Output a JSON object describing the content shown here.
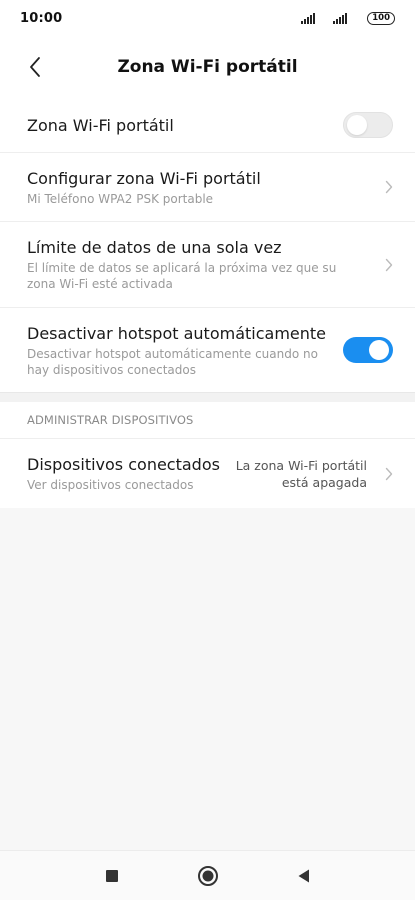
{
  "status_bar": {
    "time": "10:00",
    "battery": "100"
  },
  "header": {
    "title": "Zona Wi-Fi portátil",
    "back_icon": "chevron-left-icon"
  },
  "settings": {
    "hotspot": {
      "title": "Zona Wi-Fi portátil",
      "enabled": false
    },
    "configure": {
      "title": "Configurar zona Wi-Fi portátil",
      "subtitle": "Mi Teléfono WPA2 PSK portable"
    },
    "data_limit": {
      "title": "Límite de datos de una sola vez",
      "subtitle": "El límite de datos se aplicará la próxima vez que su zona Wi-Fi esté activada"
    },
    "auto_off": {
      "title": "Desactivar hotspot automáticamente",
      "subtitle": "Desactivar hotspot automáticamente cuando no hay dispositivos conectados",
      "enabled": true
    }
  },
  "devices_section": {
    "header": "ADMINISTRAR DISPOSITIVOS",
    "connected": {
      "title": "Dispositivos conectados",
      "subtitle": "Ver dispositivos conectados",
      "status_line1": "La zona Wi-Fi portátil",
      "status_line2": "está apagada"
    }
  },
  "nav": {
    "recents_icon": "square-icon",
    "home_icon": "circle-icon",
    "back_icon": "triangle-back-icon"
  },
  "colors": {
    "accent": "#1a8ef0",
    "background": "#f7f7f7"
  }
}
